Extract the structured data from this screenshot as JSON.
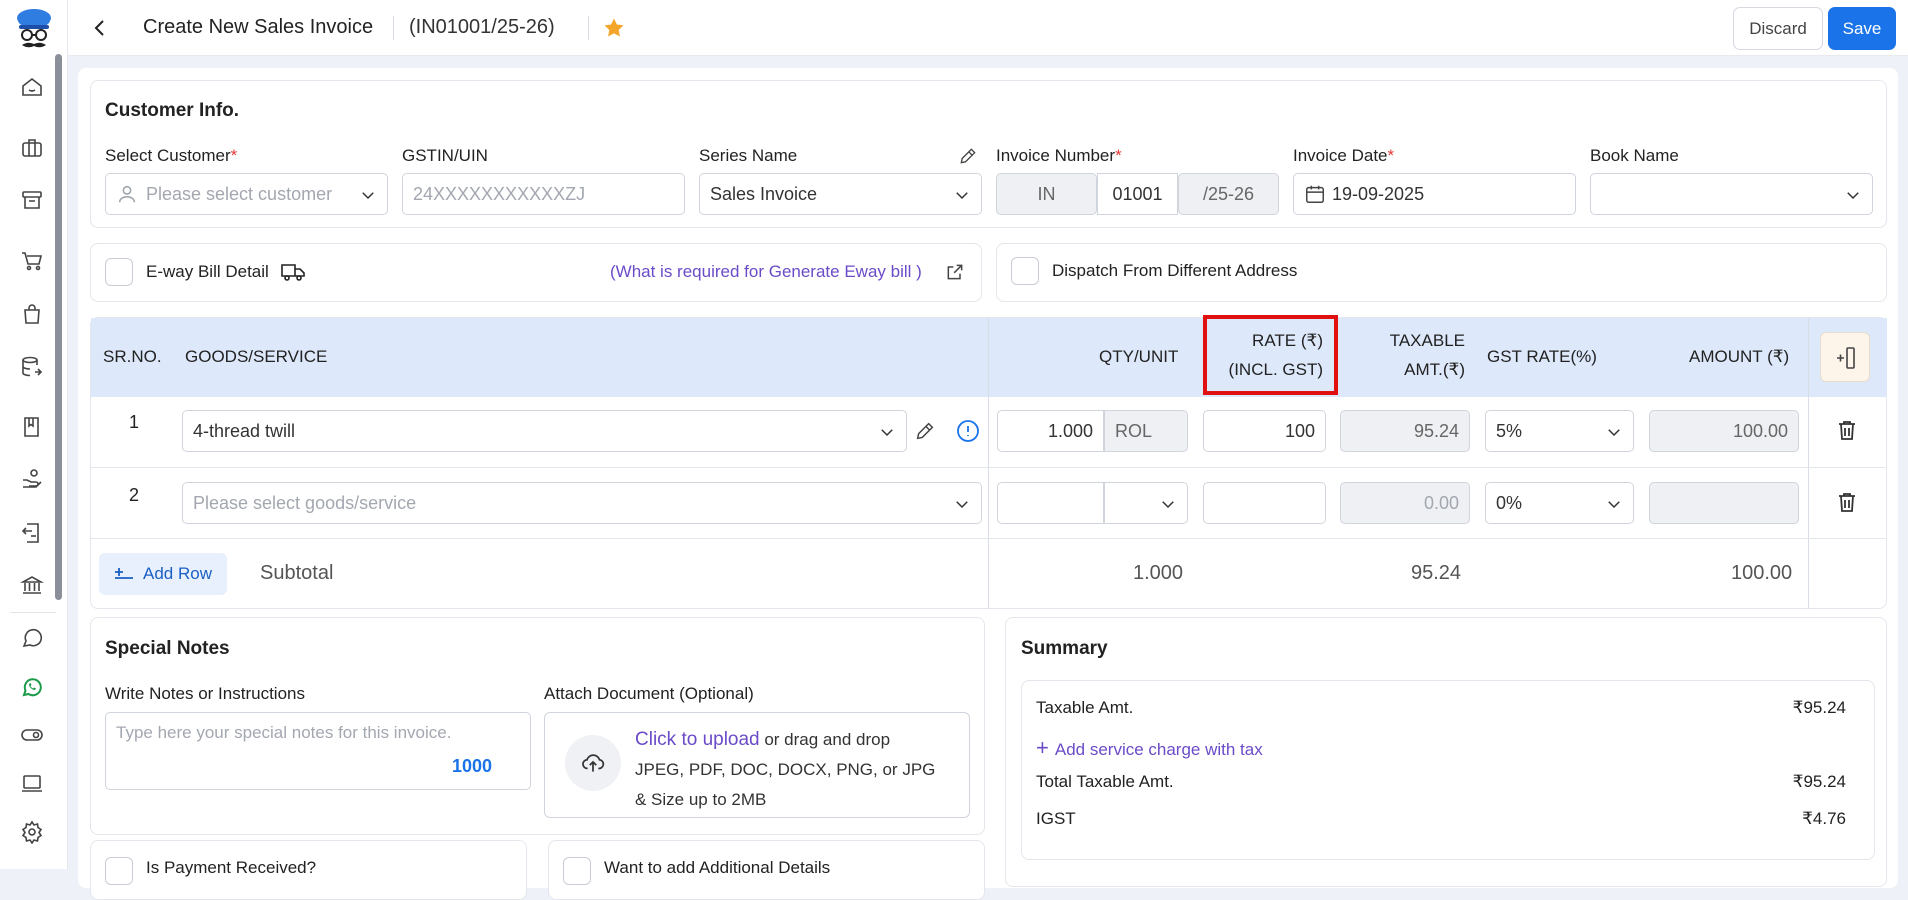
{
  "header": {
    "title": "Create New Sales Invoice",
    "invoice_no": "(IN01001/25-26)",
    "discard": "Discard",
    "save": "Save"
  },
  "colors": {
    "accent": "#1a73e8",
    "table_header": "#dde8fa",
    "required": "#e53935",
    "highlight": "#e01010",
    "star": "#f4a62a"
  },
  "sidebar_icons": [
    "home-icon",
    "briefcase-icon",
    "archive-icon",
    "cart-icon",
    "bag-icon",
    "database-export-icon",
    "book-icon",
    "hand-coins-icon",
    "receipt-return-icon",
    "bank-icon",
    "chat-icon",
    "whatsapp-icon",
    "toggle-icon",
    "monitor-icon",
    "settings-icon"
  ],
  "customer": {
    "section_title": "Customer Info.",
    "select_customer_label": "Select Customer",
    "select_customer_placeholder": "Please select customer",
    "gstin_label": "GSTIN/UIN",
    "gstin_placeholder": "24XXXXXXXXXXXZJ",
    "series_label": "Series Name",
    "series_value": "Sales Invoice",
    "invoice_number_label": "Invoice Number",
    "invoice_prefix": "IN",
    "invoice_number": "01001",
    "invoice_suffix": "/25-26",
    "invoice_date_label": "Invoice Date",
    "invoice_date": "19-09-2025",
    "book_label": "Book Name",
    "book_value": "",
    "required_mark": "*"
  },
  "eway": {
    "label": "E-way Bill Detail",
    "link": "(What is required for Generate Eway bill )",
    "dispatch_label": "Dispatch From Different Address"
  },
  "table": {
    "headers": {
      "sr": "SR.NO.",
      "goods": "GOODS/SERVICE",
      "qty": "QTY/UNIT",
      "rate_line1": "RATE (₹)",
      "rate_line2": "(INCL. GST)",
      "taxable_line1": "TAXABLE",
      "taxable_line2": "AMT.(₹)",
      "gst": "GST RATE(%)",
      "amount": "AMOUNT (₹)"
    },
    "rows": [
      {
        "sr": "1",
        "goods": "4-thread twill",
        "qty": "1.000",
        "unit": "ROL",
        "rate": "100",
        "taxable": "95.24",
        "gst": "5%",
        "amount": "100.00"
      },
      {
        "sr": "2",
        "goods": "Please select goods/service",
        "qty": "",
        "unit": "",
        "rate": "",
        "taxable": "0.00",
        "gst": "0%",
        "amount": ""
      }
    ],
    "add_row": "Add Row",
    "subtotal_label": "Subtotal",
    "subtotal_qty": "1.000",
    "subtotal_taxable": "95.24",
    "subtotal_amount": "100.00"
  },
  "notes": {
    "section_title": "Special Notes",
    "write_label": "Write Notes or Instructions",
    "placeholder": "Type here your special notes for this invoice.",
    "char_count": "1000",
    "attach_label": "Attach Document (Optional)",
    "upload_link": "Click to upload",
    "upload_rest": " or drag and drop",
    "upload_types": "JPEG, PDF, DOC, DOCX, PNG, or JPG",
    "upload_size": "& Size up to 2MB"
  },
  "bottom": {
    "payment_label": "Is Payment Received?",
    "additional_label": "Want to add Additional Details"
  },
  "summary": {
    "section_title": "Summary",
    "taxable_label": "Taxable Amt.",
    "taxable_value": "₹95.24",
    "service_charge": "Add service charge with tax",
    "total_taxable_label": "Total Taxable Amt.",
    "total_taxable_value": "₹95.24",
    "igst_label": "IGST",
    "igst_value": "₹4.76"
  }
}
